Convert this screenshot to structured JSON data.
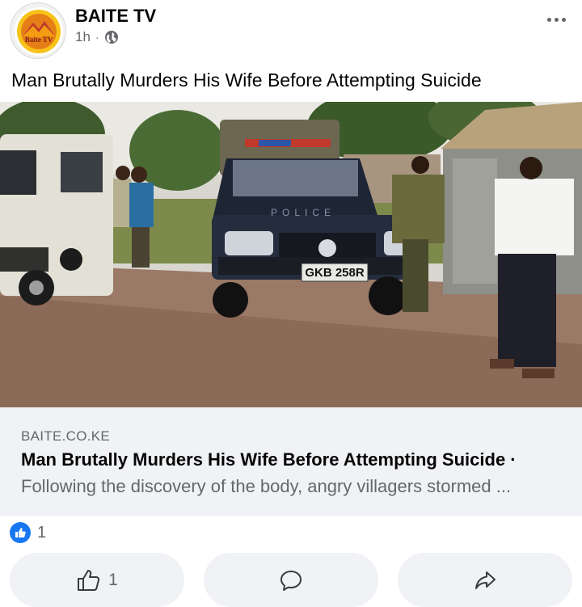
{
  "post": {
    "page_name": "BAITE TV",
    "time": "1h",
    "separator": "·",
    "audience_icon": "globe-icon",
    "more_icon": "more-options-icon",
    "text": "Man Brutally Murders His Wife Before Attempting Suicide",
    "logo_text": "Baite TV"
  },
  "photo": {
    "plate_text": "GKB 258R",
    "vehicle_text": "POLICE"
  },
  "link_preview": {
    "domain": "BAITE.CO.KE",
    "title": "Man Brutally Murders His Wife Before Attempting Suicide ·",
    "description": "Following the discovery of the body, angry villagers stormed ..."
  },
  "reactions": {
    "icon": "like-reaction-icon",
    "count": "1"
  },
  "actions": {
    "like_count": "1",
    "like_icon": "thumbs-up-icon",
    "comment_icon": "comment-icon",
    "share_icon": "share-icon"
  },
  "colors": {
    "accent": "#1877f2",
    "secondary_text": "#65676b",
    "surface": "#f0f2f5"
  }
}
